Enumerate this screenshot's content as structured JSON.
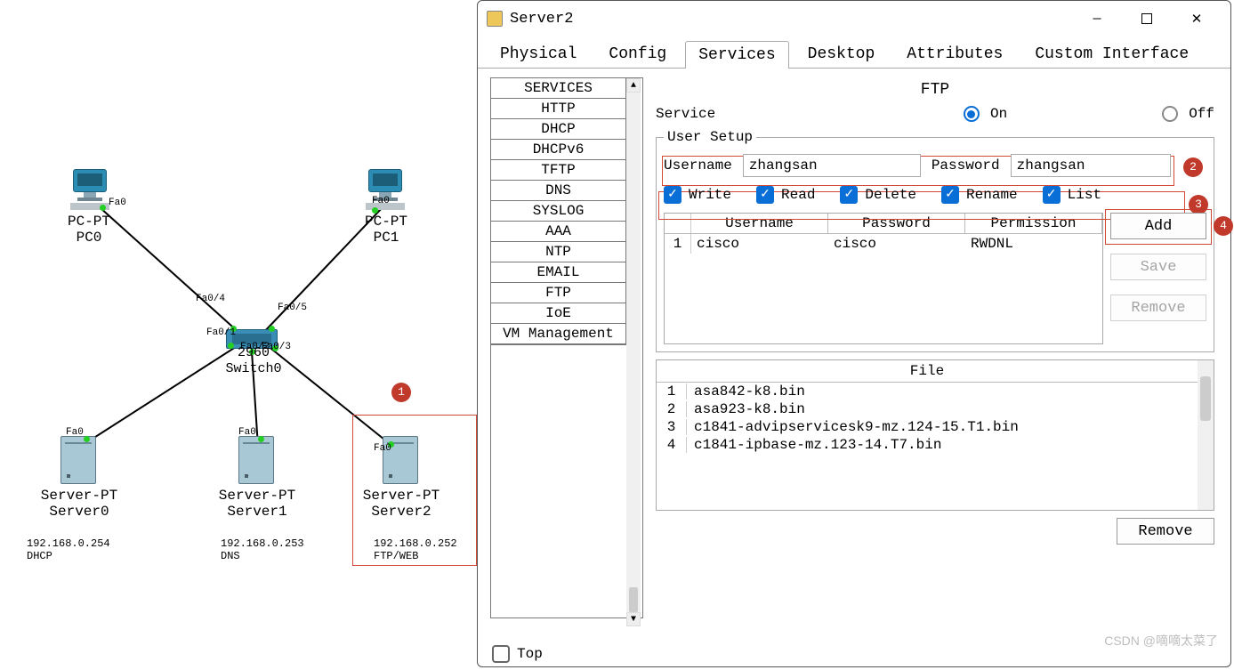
{
  "window": {
    "title": "Server2"
  },
  "tabs": {
    "physical": "Physical",
    "config": "Config",
    "services": "Services",
    "desktop": "Desktop",
    "attributes": "Attributes",
    "custom": "Custom Interface"
  },
  "services_list": {
    "0": "SERVICES",
    "1": "HTTP",
    "2": "DHCP",
    "3": "DHCPv6",
    "4": "TFTP",
    "5": "DNS",
    "6": "SYSLOG",
    "7": "AAA",
    "8": "NTP",
    "9": "EMAIL",
    "10": "FTP",
    "11": "IoE",
    "12": "VM Management"
  },
  "ftp": {
    "title": "FTP",
    "service_label": "Service",
    "on": "On",
    "off": "Off",
    "legend": "User Setup",
    "username_label": "Username",
    "username_value": "zhangsan",
    "password_label": "Password",
    "password_value": "zhangsan",
    "perm": {
      "write": "Write",
      "read": "Read",
      "delete": "Delete",
      "rename": "Rename",
      "list": "List"
    },
    "cols": {
      "user": "Username",
      "pass": "Password",
      "perm": "Permission"
    },
    "row": {
      "idx": "1",
      "user": "cisco",
      "pass": "cisco",
      "perm": "RWDNL"
    },
    "buttons": {
      "add": "Add",
      "save": "Save",
      "remove": "Remove"
    }
  },
  "files": {
    "header": "File",
    "rows": {
      "0": {
        "n": "1",
        "name": "asa842-k8.bin"
      },
      "1": {
        "n": "2",
        "name": "asa923-k8.bin"
      },
      "2": {
        "n": "3",
        "name": "c1841-advipservicesk9-mz.124-15.T1.bin"
      },
      "3": {
        "n": "4",
        "name": "c1841-ipbase-mz.123-14.T7.bin"
      }
    },
    "remove": "Remove"
  },
  "footer": {
    "top": "Top"
  },
  "topology": {
    "pc0": {
      "t": "PC-PT",
      "n": "PC0"
    },
    "pc1": {
      "t": "PC-PT",
      "n": "PC1"
    },
    "sw": {
      "t": "2960",
      "n": "Switch0"
    },
    "srv0": {
      "t": "Server-PT",
      "n": "Server0",
      "ip": "192.168.0.254",
      "svc": "DHCP"
    },
    "srv1": {
      "t": "Server-PT",
      "n": "Server1",
      "ip": "192.168.0.253",
      "svc": "DNS"
    },
    "srv2": {
      "t": "Server-PT",
      "n": "Server2",
      "ip": "192.168.0.252",
      "svc": "FTP/WEB"
    },
    "ports": {
      "fa0": "Fa0",
      "f01": "Fa0/1",
      "f02": "Fa0/2",
      "f03": "Fa0/3",
      "f04": "Fa0/4",
      "f05": "Fa0/5"
    }
  },
  "badges": {
    "1": "1",
    "2": "2",
    "3": "3",
    "4": "4"
  },
  "watermark": "CSDN @嘀嘀太菜了"
}
